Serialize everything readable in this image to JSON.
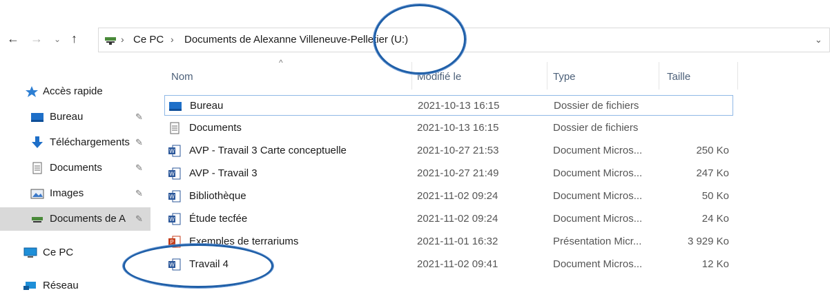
{
  "address_bar": {
    "crumbs": [
      "Ce PC",
      "Documents de Alexanne Villeneuve-Pelletier (U:)"
    ]
  },
  "sidebar": {
    "items": [
      {
        "label": "Accès rapide",
        "icon": "star-icon"
      },
      {
        "label": "Bureau",
        "icon": "desktop-folder-icon",
        "pinned": true
      },
      {
        "label": "Téléchargements",
        "icon": "download-arrow-icon",
        "pinned": true
      },
      {
        "label": "Documents",
        "icon": "document-icon",
        "pinned": true
      },
      {
        "label": "Images",
        "icon": "images-folder-icon",
        "pinned": true
      },
      {
        "label": "Documents de A",
        "icon": "network-drive-icon",
        "pinned": true,
        "selected": true
      },
      {
        "label": "Ce PC",
        "icon": "computer-icon"
      },
      {
        "label": "Réseau",
        "icon": "network-icon"
      }
    ]
  },
  "file_list": {
    "headers": {
      "name": "Nom",
      "modified": "Modifié le",
      "type": "Type",
      "size": "Taille"
    },
    "rows": [
      {
        "name": "Bureau",
        "modified": "2021-10-13 16:15",
        "type": "Dossier de fichiers",
        "size": "",
        "icon": "desktop-folder-icon"
      },
      {
        "name": "Documents",
        "modified": "2021-10-13 16:15",
        "type": "Dossier de fichiers",
        "size": "",
        "icon": "document-folder-icon"
      },
      {
        "name": "AVP - Travail 3 Carte conceptuelle",
        "modified": "2021-10-27 21:53",
        "type": "Document Micros...",
        "size": "250 Ko",
        "icon": "word-doc-icon"
      },
      {
        "name": "AVP - Travail 3",
        "modified": "2021-10-27 21:49",
        "type": "Document Micros...",
        "size": "247 Ko",
        "icon": "word-doc-icon"
      },
      {
        "name": "Bibliothèque",
        "modified": "2021-11-02 09:24",
        "type": "Document Micros...",
        "size": "50 Ko",
        "icon": "word-doc-icon"
      },
      {
        "name": "Étude tecfée",
        "modified": "2021-11-02 09:24",
        "type": "Document Micros...",
        "size": "24 Ko",
        "icon": "word-doc-icon"
      },
      {
        "name": "Exemples de terrariums",
        "modified": "2021-11-01 16:32",
        "type": "Présentation Micr...",
        "size": "3 929 Ko",
        "icon": "powerpoint-icon"
      },
      {
        "name": "Travail 4",
        "modified": "2021-11-02 09:41",
        "type": "Document Micros...",
        "size": "12 Ko",
        "icon": "word-doc-icon"
      }
    ]
  },
  "colors": {
    "accent": "#1f5fa8",
    "selection": "#d9d9d9",
    "word": "#2b579a",
    "powerpoint": "#c43e1c"
  }
}
